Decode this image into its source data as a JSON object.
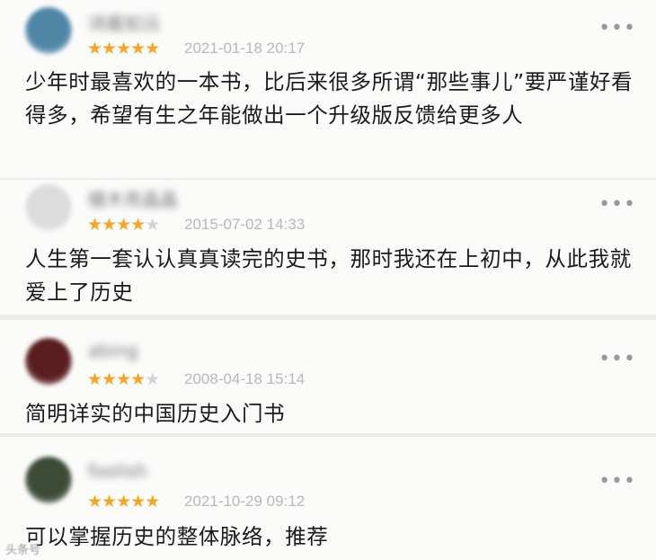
{
  "reviews": [
    {
      "username": "诗酱如沅",
      "rating": 5,
      "date": "2021-01-18 20:17",
      "text": "少年时最喜欢的一本书，比后来很多所谓“那些事儿”要严谨好看得多，希望有生之年能做出一个升级版反馈给更多人",
      "avatar_color": "#4f86a6",
      "more_label": "•••"
    },
    {
      "username": "檀木亮晶晶",
      "rating": 4,
      "date": "2015-07-02 14:33",
      "text": "人生第一套认认真真读完的史书，那时我还在上初中，从此我就爱上了历史",
      "avatar_color": "#dcdcdc",
      "more_label": "•••"
    },
    {
      "username": "abing",
      "rating": 4,
      "date": "2008-04-18 15:14",
      "text": "简明详实的中国历史入门书",
      "avatar_color": "#5a1d1f",
      "more_label": "•••"
    },
    {
      "username": "foolish",
      "rating": 5,
      "date": "2021-10-29 09:12",
      "text": "可以掌握历史的整体脉络，推荐",
      "avatar_color": "#3c4a36",
      "more_label": "•••"
    }
  ],
  "watermark": "头条号"
}
